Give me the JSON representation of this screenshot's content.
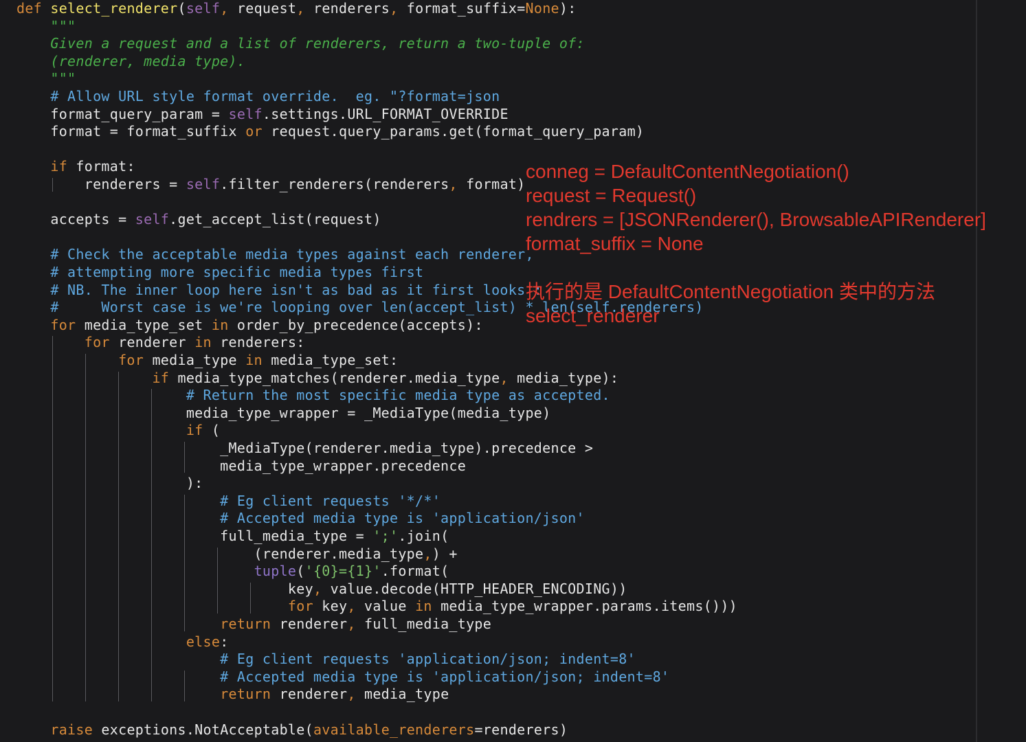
{
  "editor": {
    "lines": [
      [
        {
          "t": "def ",
          "c": "kw"
        },
        {
          "t": "select_renderer",
          "c": "fn"
        },
        {
          "t": "(",
          "c": "plain"
        },
        {
          "t": "self",
          "c": "self"
        },
        {
          "t": ", ",
          "c": "kw"
        },
        {
          "t": "request",
          "c": "plain"
        },
        {
          "t": ", ",
          "c": "kw"
        },
        {
          "t": "renderers",
          "c": "plain"
        },
        {
          "t": ", ",
          "c": "kw"
        },
        {
          "t": "format_suffix",
          "c": "plain"
        },
        {
          "t": "=",
          "c": "plain"
        },
        {
          "t": "None",
          "c": "kw"
        },
        {
          "t": "):",
          "c": "plain"
        }
      ],
      [
        {
          "t": "    \"\"\"",
          "c": "doc"
        }
      ],
      [
        {
          "t": "    Given a request and a list of renderers, return a two-tuple of:",
          "c": "doc"
        }
      ],
      [
        {
          "t": "    (renderer, media type).",
          "c": "doc"
        }
      ],
      [
        {
          "t": "    \"\"\"",
          "c": "doc"
        }
      ],
      [
        {
          "t": "    # Allow URL style format override.  eg. \"?format=json",
          "c": "cm"
        }
      ],
      [
        {
          "t": "    format_query_param = ",
          "c": "plain"
        },
        {
          "t": "self",
          "c": "self"
        },
        {
          "t": ".settings.URL_FORMAT_OVERRIDE",
          "c": "plain"
        }
      ],
      [
        {
          "t": "    format = format_suffix ",
          "c": "plain"
        },
        {
          "t": "or",
          "c": "kw"
        },
        {
          "t": " request.query_params.get(format_query_param)",
          "c": "plain"
        }
      ],
      [],
      [
        {
          "t": "    ",
          "c": "plain"
        },
        {
          "t": "if",
          "c": "kw"
        },
        {
          "t": " format:",
          "c": "plain"
        }
      ],
      [
        {
          "t": "        renderers = ",
          "c": "plain"
        },
        {
          "t": "self",
          "c": "self"
        },
        {
          "t": ".filter_renderers(renderers",
          "c": "plain"
        },
        {
          "t": ", ",
          "c": "kw"
        },
        {
          "t": "format)",
          "c": "plain"
        }
      ],
      [],
      [
        {
          "t": "    accepts = ",
          "c": "plain"
        },
        {
          "t": "self",
          "c": "self"
        },
        {
          "t": ".get_accept_list(request)",
          "c": "plain"
        }
      ],
      [],
      [
        {
          "t": "    # Check the acceptable media types against each renderer,",
          "c": "cm"
        }
      ],
      [
        {
          "t": "    # attempting more specific media types first",
          "c": "cm"
        }
      ],
      [
        {
          "t": "    # NB. The inner loop here isn't as bad as it first looks :",
          "c": "cm"
        }
      ],
      [
        {
          "t": "    #     Worst case is we're looping over len(accept_list) * len(self.renderers)",
          "c": "cm"
        }
      ],
      [
        {
          "t": "    ",
          "c": "plain"
        },
        {
          "t": "for",
          "c": "kw"
        },
        {
          "t": " media_type_set ",
          "c": "plain"
        },
        {
          "t": "in",
          "c": "kw"
        },
        {
          "t": " order_by_precedence(accepts):",
          "c": "plain"
        }
      ],
      [
        {
          "t": "        ",
          "c": "plain"
        },
        {
          "t": "for",
          "c": "kw"
        },
        {
          "t": " renderer ",
          "c": "plain"
        },
        {
          "t": "in",
          "c": "kw"
        },
        {
          "t": " renderers:",
          "c": "plain"
        }
      ],
      [
        {
          "t": "            ",
          "c": "plain"
        },
        {
          "t": "for",
          "c": "kw"
        },
        {
          "t": " media_type ",
          "c": "plain"
        },
        {
          "t": "in",
          "c": "kw"
        },
        {
          "t": " media_type_set:",
          "c": "plain"
        }
      ],
      [
        {
          "t": "                ",
          "c": "plain"
        },
        {
          "t": "if",
          "c": "kw"
        },
        {
          "t": " media_type_matches(renderer.media_type",
          "c": "plain"
        },
        {
          "t": ", ",
          "c": "kw"
        },
        {
          "t": "media_type):",
          "c": "plain"
        }
      ],
      [
        {
          "t": "                    # Return the most specific media type as accepted.",
          "c": "cm"
        }
      ],
      [
        {
          "t": "                    media_type_wrapper = _MediaType(media_type)",
          "c": "plain"
        }
      ],
      [
        {
          "t": "                    ",
          "c": "plain"
        },
        {
          "t": "if",
          "c": "kw"
        },
        {
          "t": " (",
          "c": "plain"
        }
      ],
      [
        {
          "t": "                        _MediaType(renderer.media_type).precedence >",
          "c": "plain"
        }
      ],
      [
        {
          "t": "                        media_type_wrapper.precedence",
          "c": "plain"
        }
      ],
      [
        {
          "t": "                    ):",
          "c": "plain"
        }
      ],
      [
        {
          "t": "                        # Eg client requests '*/*'",
          "c": "cm"
        }
      ],
      [
        {
          "t": "                        # Accepted media type is 'application/json'",
          "c": "cm"
        }
      ],
      [
        {
          "t": "                        full_media_type = ",
          "c": "plain"
        },
        {
          "t": "';'",
          "c": "str"
        },
        {
          "t": ".join(",
          "c": "plain"
        }
      ],
      [
        {
          "t": "                            (renderer.media_type",
          "c": "plain"
        },
        {
          "t": ",",
          "c": "kw"
        },
        {
          "t": ") +",
          "c": "plain"
        }
      ],
      [
        {
          "t": "                            ",
          "c": "plain"
        },
        {
          "t": "tuple",
          "c": "builtin"
        },
        {
          "t": "(",
          "c": "plain"
        },
        {
          "t": "'{0}={1}'",
          "c": "str"
        },
        {
          "t": ".format(",
          "c": "plain"
        }
      ],
      [
        {
          "t": "                                key",
          "c": "plain"
        },
        {
          "t": ", ",
          "c": "kw"
        },
        {
          "t": "value.decode(HTTP_HEADER_ENCODING))",
          "c": "plain"
        }
      ],
      [
        {
          "t": "                                ",
          "c": "plain"
        },
        {
          "t": "for",
          "c": "kw"
        },
        {
          "t": " key",
          "c": "plain"
        },
        {
          "t": ", ",
          "c": "kw"
        },
        {
          "t": "value ",
          "c": "plain"
        },
        {
          "t": "in",
          "c": "kw"
        },
        {
          "t": " media_type_wrapper.params.items()))",
          "c": "plain"
        }
      ],
      [
        {
          "t": "                        ",
          "c": "plain"
        },
        {
          "t": "return",
          "c": "kw"
        },
        {
          "t": " renderer",
          "c": "plain"
        },
        {
          "t": ", ",
          "c": "kw"
        },
        {
          "t": "full_media_type",
          "c": "plain"
        }
      ],
      [
        {
          "t": "                    ",
          "c": "plain"
        },
        {
          "t": "else",
          "c": "kw"
        },
        {
          "t": ":",
          "c": "plain"
        }
      ],
      [
        {
          "t": "                        # Eg client requests 'application/json; indent=8'",
          "c": "cm"
        }
      ],
      [
        {
          "t": "                        # Accepted media type is 'application/json; indent=8'",
          "c": "cm"
        }
      ],
      [
        {
          "t": "                        ",
          "c": "plain"
        },
        {
          "t": "return",
          "c": "kw"
        },
        {
          "t": " renderer",
          "c": "plain"
        },
        {
          "t": ", ",
          "c": "kw"
        },
        {
          "t": "media_type",
          "c": "plain"
        }
      ],
      [],
      [
        {
          "t": "    ",
          "c": "plain"
        },
        {
          "t": "raise",
          "c": "kw"
        },
        {
          "t": " exceptions.NotAcceptable(",
          "c": "plain"
        },
        {
          "t": "available_renderers",
          "c": "param"
        },
        {
          "t": "=renderers)",
          "c": "plain"
        }
      ]
    ]
  },
  "annotation": {
    "lines": [
      "conneg = DefaultContentNegotiation()",
      "request = Request()",
      "rendrers = [JSONRenderer(), BrowsableAPIRenderer]",
      "format_suffix = None",
      "",
      "执行的是 DefaultContentNegotiation 类中的方法",
      "select_renderer"
    ]
  },
  "colors": {
    "background": "#1a1a1c",
    "keyword": "#d78a3a",
    "function": "#f0e26a",
    "self": "#9b6bb3",
    "docstring": "#4bb04b",
    "comment": "#5fa8e0",
    "string": "#7ec16a",
    "annotation": "#e2392e"
  }
}
